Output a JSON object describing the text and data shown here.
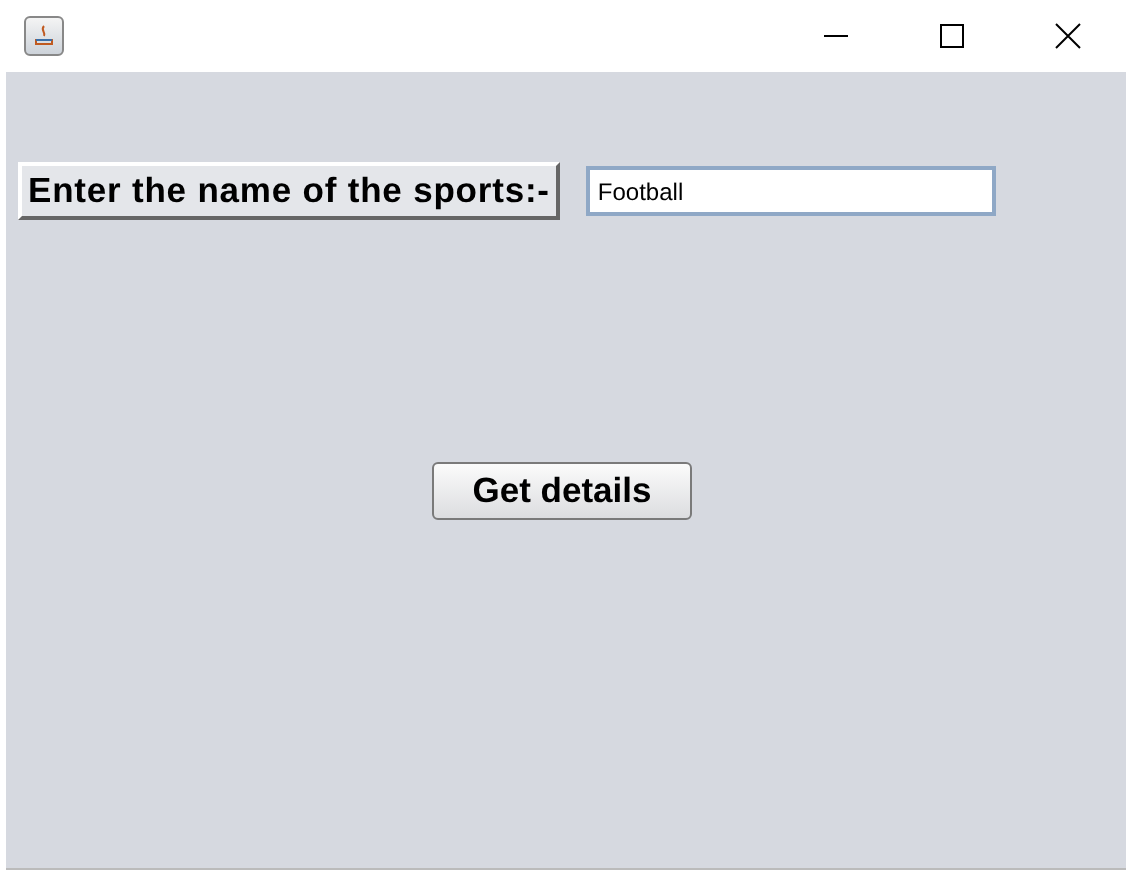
{
  "form": {
    "label": "Enter the name of the sports:-",
    "field": {
      "value": "Football"
    },
    "button": "Get details"
  }
}
